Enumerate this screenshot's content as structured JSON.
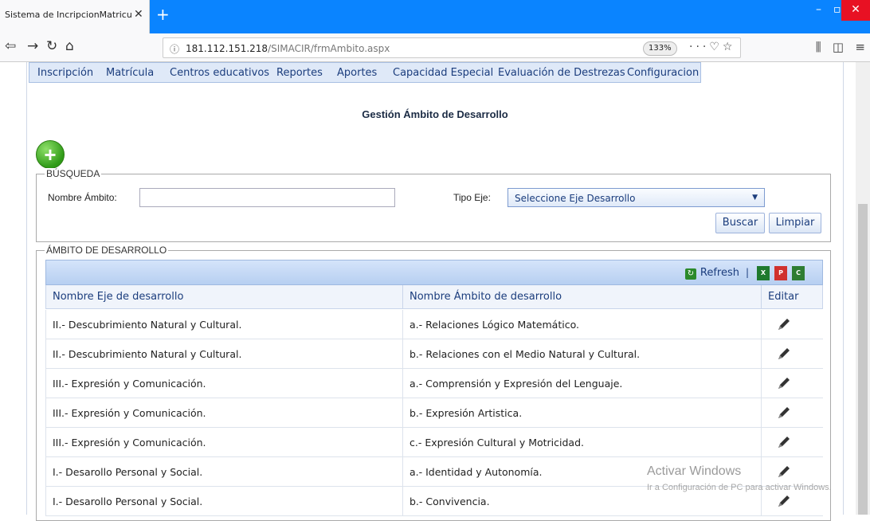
{
  "browser": {
    "tab_title": "Sistema de IncripcionMatriculación",
    "tab_close": "✕",
    "new_tab": "+",
    "url_info_icon": "ⓘ",
    "url_host": "181.112.151.218",
    "url_path": "/SIMACIR/frmAmbito.aspx",
    "zoom": "133%"
  },
  "menu": {
    "items": [
      "Inscripción",
      "Matrícula",
      "Centros educativos",
      "Reportes",
      "Aportes",
      "Capacidad Especial",
      "Evaluación de Destrezas",
      "Configuracion"
    ]
  },
  "page": {
    "title": "Gestión Ámbito de Desarrollo",
    "add_label": "+"
  },
  "search": {
    "legend": "BÚSQUEDA",
    "nombre_label": "Nombre Ámbito:",
    "nombre_value": "",
    "tipo_label": "Tipo Eje:",
    "tipo_value": "Seleccione Eje Desarrollo",
    "buscar": "Buscar",
    "limpiar": "Limpiar"
  },
  "results": {
    "legend": "ÁMBITO DE DESARROLLO",
    "refresh": "Refresh",
    "separator": "|",
    "columns": [
      "Nombre Eje de desarrollo",
      "Nombre Ámbito de desarrollo",
      "Editar"
    ],
    "rows": [
      [
        "II.- Descubrimiento Natural y Cultural.",
        "a.- Relaciones Lógico Matemático."
      ],
      [
        "II.- Descubrimiento Natural y Cultural.",
        "b.- Relaciones con el Medio Natural y Cultural."
      ],
      [
        "III.- Expresión y Comunicación.",
        "a.- Comprensión y Expresión del Lenguaje."
      ],
      [
        "III.- Expresión y Comunicación.",
        "b.- Expresión Artistica."
      ],
      [
        "III.- Expresión y Comunicación.",
        "c.- Expresión Cultural y Motricidad."
      ],
      [
        "I.- Desarollo Personal y Social.",
        "a.- Identidad y Autonomía."
      ],
      [
        "I.- Desarollo Personal y Social.",
        "b.- Convivencia."
      ]
    ]
  },
  "watermark": {
    "line1": "Activar Windows",
    "line2": "Ir a Configuración de PC para activar Windows."
  }
}
